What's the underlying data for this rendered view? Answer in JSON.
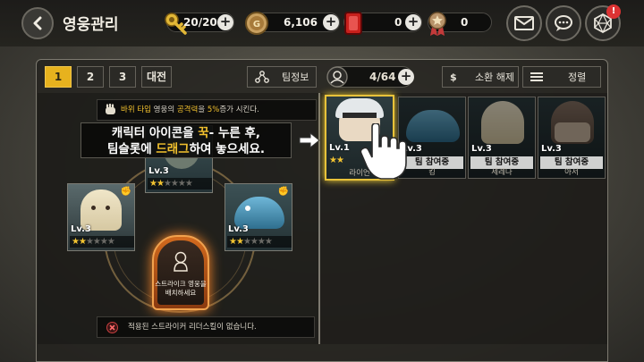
{
  "header": {
    "title": "영웅관리",
    "stamina": "20/20",
    "gold": "6,106",
    "ruby": "0",
    "medal": "0",
    "notification_count": "!"
  },
  "tabs": [
    "1",
    "2",
    "3",
    "대전"
  ],
  "toolbar": {
    "team_info": "팀정보",
    "hero_count": "4/64",
    "summon_cancel": "소환 해제",
    "sort": "정렬",
    "dollar": "$"
  },
  "formation": {
    "bonus_text_1": "바위 타입",
    "bonus_text_2": " 영웅의 ",
    "bonus_text_3": "공격력",
    "bonus_text_4": "을 ",
    "bonus_text_5": "5%",
    "bonus_text_6": "증가 시킨다.",
    "tutorial_line1_a": "캐릭터 아이콘을 ",
    "tutorial_line1_b": "꾹",
    "tutorial_line1_c": "- 누른 후,",
    "tutorial_line2_a": "팀슬롯에 ",
    "tutorial_line2_b": "드래그",
    "tutorial_line2_c": "하여 놓으세요.",
    "slots": [
      {
        "level": "Lv.3",
        "stars": 2,
        "max_stars": 6
      },
      {
        "level": "Lv.3",
        "stars": 2,
        "max_stars": 6
      },
      {
        "level": "Lv.3",
        "stars": 2,
        "max_stars": 6
      }
    ],
    "strike_slot_text": "스트라이크 영웅을 배치하세요",
    "leader_text": "적용된 스트라이커 리더스킬이 없습니다."
  },
  "roster": [
    {
      "level": "Lv.1",
      "stars": 2,
      "name": "라이언",
      "tag": "",
      "selected": true
    },
    {
      "level": "Lv.3",
      "stars": 0,
      "name": "킹",
      "tag": "팀 참여중",
      "selected": false
    },
    {
      "level": "Lv.3",
      "stars": 0,
      "name": "세레나",
      "tag": "팀 참여중",
      "selected": false
    },
    {
      "level": "Lv.3",
      "stars": 0,
      "name": "아서",
      "tag": "팀 참여중",
      "selected": false
    }
  ],
  "colors": {
    "accent": "#e7b21e",
    "strike": "#d26a1e",
    "star": "#f3c431"
  }
}
